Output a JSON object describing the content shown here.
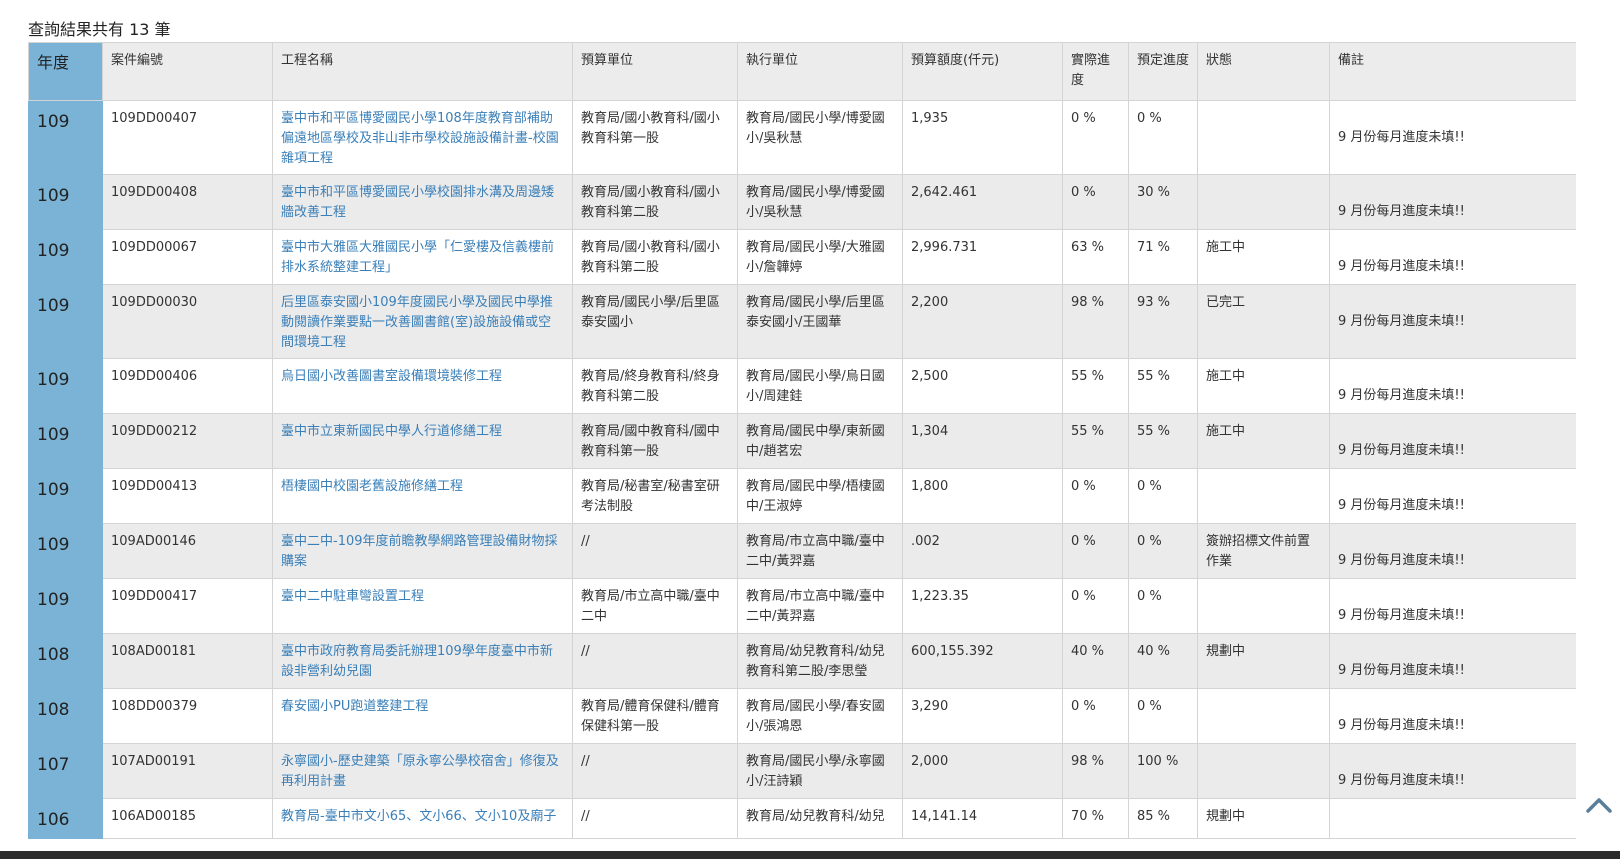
{
  "result_summary": "查詢結果共有 13 筆",
  "columns": {
    "year": "年度",
    "case_no": "案件編號",
    "project_name": "工程名稱",
    "budget_unit": "預算單位",
    "exec_unit": "執行單位",
    "budget_amount": "預算額度(仟元)",
    "actual_progress": "實際進度",
    "planned_progress": "預定進度",
    "status": "狀態",
    "note": "備註"
  },
  "rows": [
    {
      "year": "109",
      "case_no": "109DD00407",
      "name": "臺中市和平區博愛國民小學108年度教育部補助偏遠地區學校及非山非市學校設施設備計畫-校園雜項工程",
      "budget_unit": "教育局/國小教育科/國小教育科第一股",
      "exec_unit": "教育局/國民小學/博愛國小/吳秋慧",
      "amount": "1,935",
      "actual": "0 %",
      "planned": "0 %",
      "status": "",
      "note": "9 月份每月進度未填!!"
    },
    {
      "year": "109",
      "case_no": "109DD00408",
      "name": "臺中市和平區博愛國民小學校園排水溝及周邊矮牆改善工程",
      "budget_unit": "教育局/國小教育科/國小教育科第二股",
      "exec_unit": "教育局/國民小學/博愛國小/吳秋慧",
      "amount": "2,642.461",
      "actual": "0 %",
      "planned": "30 %",
      "status": "",
      "note": "9 月份每月進度未填!!"
    },
    {
      "year": "109",
      "case_no": "109DD00067",
      "name": "臺中市大雅區大雅國民小學「仁愛樓及信義樓前排水系統整建工程」",
      "budget_unit": "教育局/國小教育科/國小教育科第二股",
      "exec_unit": "教育局/國民小學/大雅國小/詹韡婷",
      "amount": "2,996.731",
      "actual": "63 %",
      "planned": "71 %",
      "status": "施工中",
      "note": "9 月份每月進度未填!!"
    },
    {
      "year": "109",
      "case_no": "109DD00030",
      "name": "后里區泰安國小109年度國民小學及國民中學推動閱讀作業要點一改善圖書館(室)設施設備或空間環境工程",
      "budget_unit": "教育局/國民小學/后里區泰安國小",
      "exec_unit": "教育局/國民小學/后里區泰安國小/王國華",
      "amount": "2,200",
      "actual": "98 %",
      "planned": "93 %",
      "status": "已完工",
      "note": "9 月份每月進度未填!!"
    },
    {
      "year": "109",
      "case_no": "109DD00406",
      "name": "烏日國小改善圖書室設備環境裝修工程",
      "budget_unit": "教育局/終身教育科/終身教育科第二股",
      "exec_unit": "教育局/國民小學/烏日國小/周建銈",
      "amount": "2,500",
      "actual": "55 %",
      "planned": "55 %",
      "status": "施工中",
      "note": "9 月份每月進度未填!!"
    },
    {
      "year": "109",
      "case_no": "109DD00212",
      "name": "臺中市立東新國民中學人行道修繕工程",
      "budget_unit": "教育局/國中教育科/國中教育科第一股",
      "exec_unit": "教育局/國民中學/東新國中/趙茗宏",
      "amount": "1,304",
      "actual": "55 %",
      "planned": "55 %",
      "status": "施工中",
      "note": "9 月份每月進度未填!!"
    },
    {
      "year": "109",
      "case_no": "109DD00413",
      "name": "梧棲國中校園老舊設施修繕工程",
      "budget_unit": "教育局/秘書室/秘書室研考法制股",
      "exec_unit": "教育局/國民中學/梧棲國中/王淑婷",
      "amount": "1,800",
      "actual": "0 %",
      "planned": "0 %",
      "status": "",
      "note": "9 月份每月進度未填!!"
    },
    {
      "year": "109",
      "case_no": "109AD00146",
      "name": "臺中二中-109年度前瞻教學網路管理設備財物採購案",
      "budget_unit": "//",
      "exec_unit": "教育局/市立高中職/臺中二中/黃羿嘉",
      "amount": ".002",
      "actual": "0 %",
      "planned": "0 %",
      "status": "簽辦招標文件前置作業",
      "note": "9 月份每月進度未填!!"
    },
    {
      "year": "109",
      "case_no": "109DD00417",
      "name": "臺中二中駐車彎設置工程",
      "budget_unit": "教育局/市立高中職/臺中二中",
      "exec_unit": "教育局/市立高中職/臺中二中/黃羿嘉",
      "amount": "1,223.35",
      "actual": "0 %",
      "planned": "0 %",
      "status": "",
      "note": "9 月份每月進度未填!!"
    },
    {
      "year": "108",
      "case_no": "108AD00181",
      "name": "臺中市政府教育局委託辦理109學年度臺中市新設非營利幼兒園",
      "budget_unit": "//",
      "exec_unit": "教育局/幼兒教育科/幼兒教育科第二股/李思瑩",
      "amount": "600,155.392",
      "actual": "40 %",
      "planned": "40 %",
      "status": "規劃中",
      "note": "9 月份每月進度未填!!"
    },
    {
      "year": "108",
      "case_no": "108DD00379",
      "name": "春安國小PU跑道整建工程",
      "budget_unit": "教育局/體育保健科/體育保健科第一股",
      "exec_unit": "教育局/國民小學/春安國小/張鴻恩",
      "amount": "3,290",
      "actual": "0 %",
      "planned": "0 %",
      "status": "",
      "note": "9 月份每月進度未填!!"
    },
    {
      "year": "107",
      "case_no": "107AD00191",
      "name": "永寧國小-歷史建築「原永寧公學校宿舍」修復及再利用計畫",
      "budget_unit": "//",
      "exec_unit": "教育局/國民小學/永寧國小/汪詩穎",
      "amount": "2,000",
      "actual": "98 %",
      "planned": "100 %",
      "status": "",
      "note": "9 月份每月進度未填!!"
    },
    {
      "year": "106",
      "case_no": "106AD00185",
      "name": "教育局-臺中市文小65、文小66、文小10及廟子",
      "budget_unit": "//",
      "exec_unit": "教育局/幼兒教育科/幼兒",
      "amount": "14,141.14",
      "actual": "70 %",
      "planned": "85 %",
      "status": "規劃中",
      "note": ""
    }
  ],
  "icons": {
    "back_to_top": "chevron-up-icon"
  },
  "colors": {
    "year_column": "#7ab3d6",
    "link": "#3a7fb8",
    "row_alt": "#ebebeb"
  }
}
